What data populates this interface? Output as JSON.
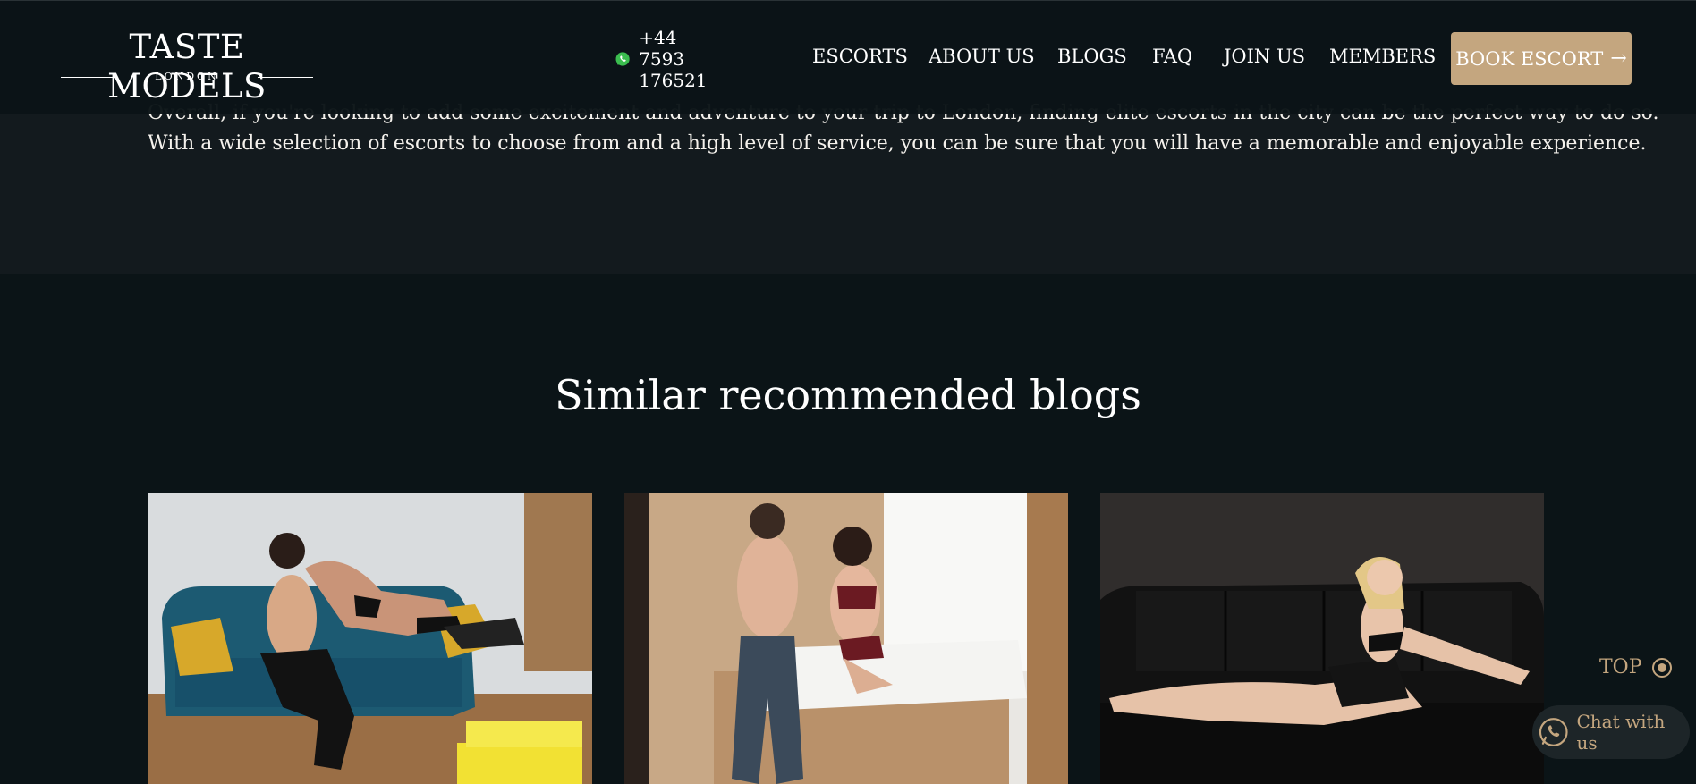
{
  "brand": {
    "name": "TASTE MODELS",
    "city": "LONDON"
  },
  "header": {
    "phone": "+44 7593 176521",
    "nav": [
      "ESCORTS",
      "ABOUT US",
      "BLOGS",
      "FAQ",
      "JOIN US",
      "MEMBERS"
    ],
    "cta": "BOOK ESCORT"
  },
  "article": {
    "line1": "Overall, if you're looking to add some excitement and adventure to your trip to London, finding elite escorts in the city can be the perfect way to do so.",
    "line2": "With a wide selection of escorts to choose from and a high level of service, you can be sure that you will have a memorable and enjoyable experience."
  },
  "recommended": {
    "title": "Similar recommended blogs",
    "cards": [
      {
        "image": "couple-on-teal-sofa-photo"
      },
      {
        "image": "couple-by-bed-photo"
      },
      {
        "image": "woman-on-black-leather-sofa-photo"
      }
    ]
  },
  "floating": {
    "top_label": "TOP",
    "chat_label": "Chat with us"
  },
  "colors": {
    "background": "#0b1417",
    "article_bg": "#131a1e",
    "accent": "#c4a67f",
    "text": "#f4f1ec"
  }
}
